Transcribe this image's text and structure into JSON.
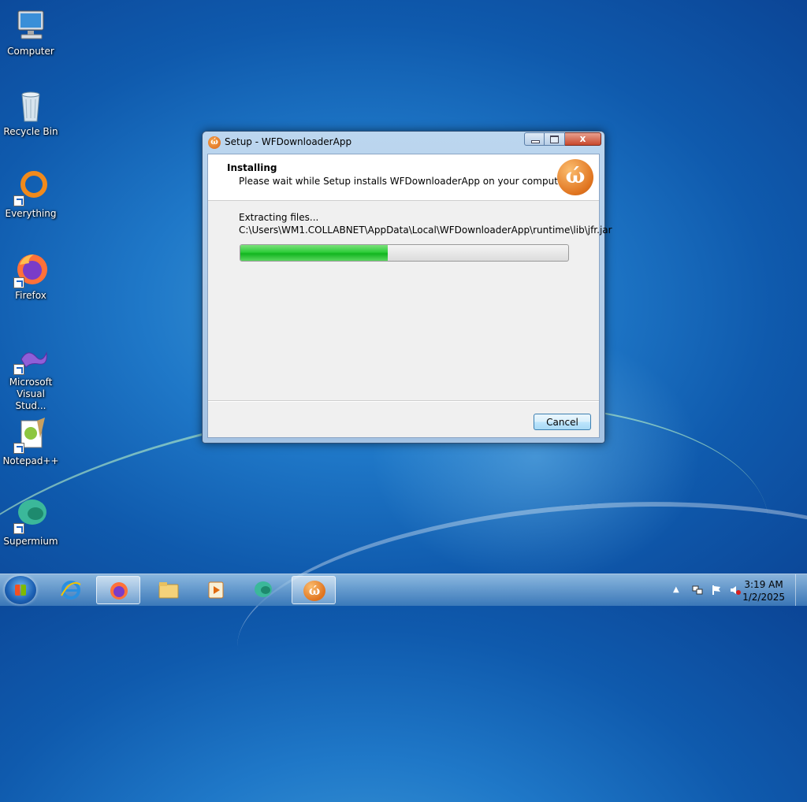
{
  "desktop": {
    "icons": [
      {
        "label": "Computer"
      },
      {
        "label": "Recycle Bin"
      },
      {
        "label": "Everything"
      },
      {
        "label": "Firefox"
      },
      {
        "label": "Microsoft Visual Stud..."
      },
      {
        "label": "Notepad++"
      },
      {
        "label": "Supermium"
      }
    ]
  },
  "window": {
    "title": "Setup - WFDownloaderApp",
    "close_glyph": "x",
    "header": {
      "title": "Installing",
      "subtitle": "Please wait while Setup installs WFDownloaderApp on your computer."
    },
    "status": "Extracting files...",
    "current_file": "C:\\Users\\WM1.COLLABNET\\AppData\\Local\\WFDownloaderApp\\runtime\\lib\\jfr.jar",
    "progress_percent": 45,
    "cancel_label": "Cancel"
  },
  "taskbar": {
    "apps": [
      "internet-explorer",
      "firefox",
      "file-explorer",
      "media-player",
      "supermium",
      "wfdownloaderapp"
    ],
    "clock": {
      "time": "3:19 AM",
      "date": "1/2/2025"
    }
  },
  "colors": {
    "progress_fill": "#2fcd3a",
    "desktop_bg": "#1f78c8",
    "accent_orange": "#e0741f"
  }
}
